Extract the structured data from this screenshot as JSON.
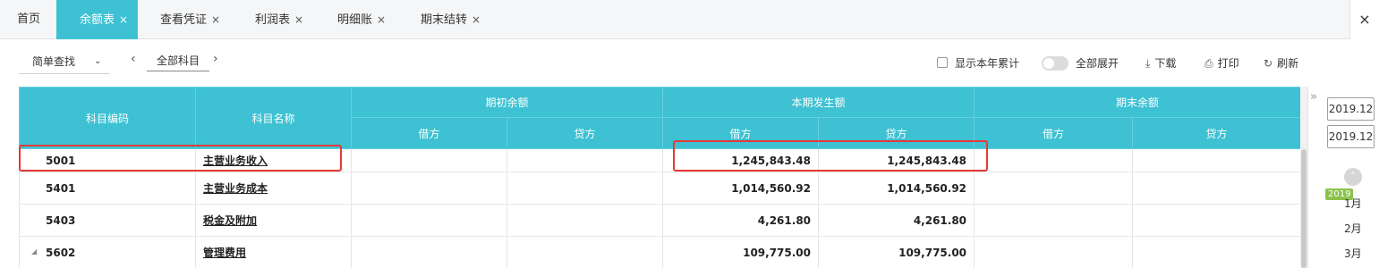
{
  "tabs": [
    {
      "label": "首页",
      "closable": false
    },
    {
      "label": "余额表",
      "closable": true,
      "active": true
    },
    {
      "label": "查看凭证",
      "closable": true
    },
    {
      "label": "利润表",
      "closable": true
    },
    {
      "label": "明细账",
      "closable": true
    },
    {
      "label": "期末结转",
      "closable": true
    }
  ],
  "close_glyph": "×",
  "toolbar": {
    "search_mode": "简单查找",
    "subject_filter": "全部科目",
    "show_year_total": "显示本年累计",
    "expand_all": "全部展开",
    "download": "下载",
    "print": "打印",
    "refresh": "刷新"
  },
  "table": {
    "headers": {
      "code": "科目编码",
      "name": "科目名称",
      "opening": "期初余额",
      "current": "本期发生额",
      "closing": "期末余额",
      "debit": "借方",
      "credit": "贷方"
    },
    "rows": [
      {
        "code": "5001",
        "name": "主营业务收入",
        "open_debit": "",
        "open_credit": "",
        "cur_debit": "1,245,843.48",
        "cur_credit": "1,245,843.48",
        "close_debit": "",
        "close_credit": ""
      },
      {
        "code": "5401",
        "name": "主营业务成本",
        "open_debit": "",
        "open_credit": "",
        "cur_debit": "1,014,560.92",
        "cur_credit": "1,014,560.92",
        "close_debit": "",
        "close_credit": ""
      },
      {
        "code": "5403",
        "name": "税金及附加",
        "open_debit": "",
        "open_credit": "",
        "cur_debit": "4,261.80",
        "cur_credit": "4,261.80",
        "close_debit": "",
        "close_credit": ""
      },
      {
        "code": "5602",
        "name": "管理费用",
        "open_debit": "",
        "open_credit": "",
        "cur_debit": "109,775.00",
        "cur_credit": "109,775.00",
        "close_debit": "",
        "close_credit": ""
      }
    ]
  },
  "period_panel": {
    "start": "2019.12",
    "end": "2019.12",
    "year": "2019",
    "months": [
      "1月",
      "2月",
      "3月"
    ]
  },
  "colors": {
    "accent": "#3dc1d3",
    "highlight": "#e53935",
    "year_tag": "#8bc34a"
  }
}
